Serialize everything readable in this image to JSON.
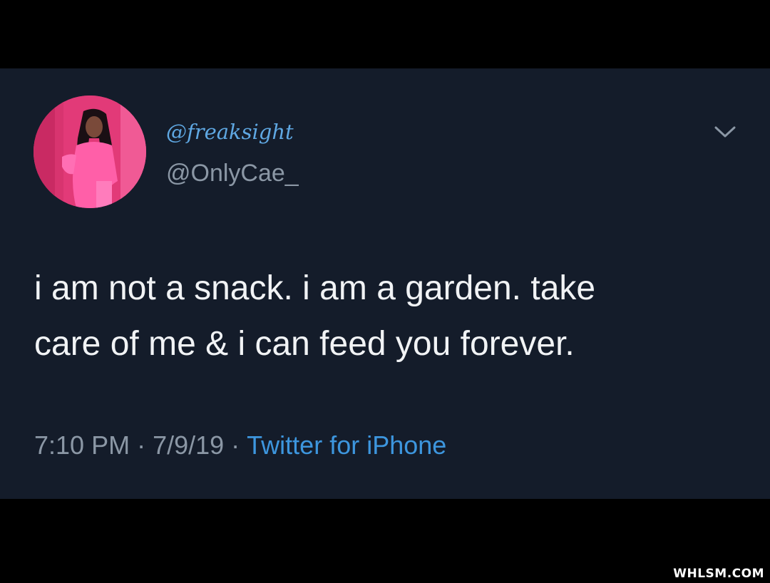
{
  "tweet": {
    "display_name": "@freaksight",
    "handle": "@OnlyCae_",
    "text_line1": "i am not a snack. i am a garden. take",
    "text_line2": "care of me & i can feed you forever.",
    "time": "7:10 PM",
    "date": "7/9/19",
    "separator": "·",
    "source": "Twitter for iPhone",
    "avatar_icon": "profile-photo",
    "more_icon": "chevron-down-icon"
  },
  "watermark": {
    "text": "WHLSM.COM"
  },
  "colors": {
    "background": "#000000",
    "card": "#141c2a",
    "text": "#f1f3f5",
    "muted": "#8b97a5",
    "link": "#3d96de",
    "display_name": "#5fa8e3"
  }
}
